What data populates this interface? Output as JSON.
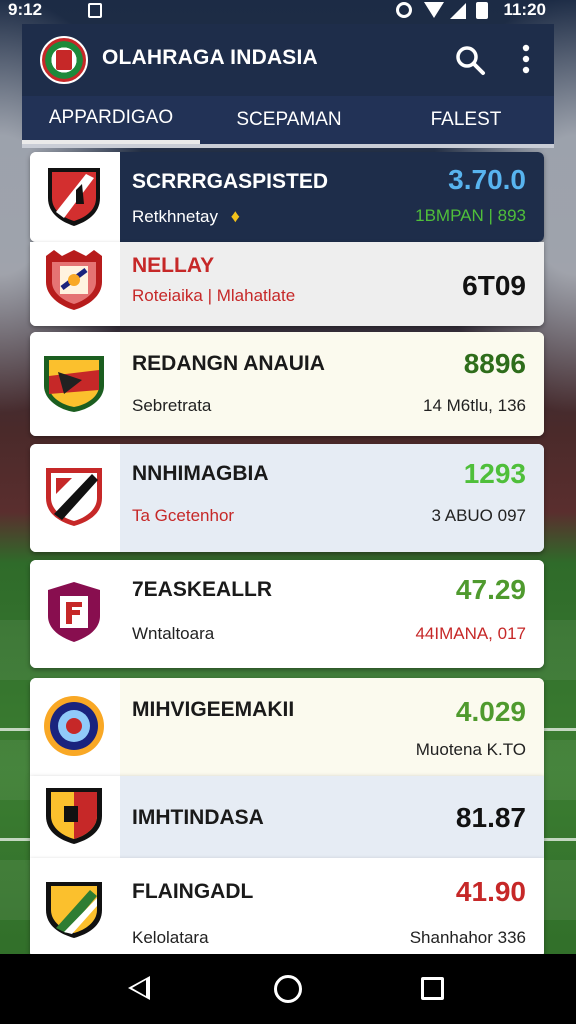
{
  "status_bar": {
    "time": "9:12",
    "clock": "11:20"
  },
  "app": {
    "title": "OLAHRAGA INDASIA"
  },
  "tabs": [
    {
      "label": "APPARDIGAO",
      "active": true
    },
    {
      "label": "SCEPAMAN",
      "active": false
    },
    {
      "label": "FALEST",
      "active": false
    }
  ],
  "items": [
    {
      "name": "SCRRRGASPISTED",
      "sub": "Retkhnetay",
      "score": "3.70.0",
      "meta": "1BMPAN | 893",
      "theme": "dark",
      "score_color": "#58b4ef",
      "meta_color": "#4fbf3a",
      "sub_badge": "trophy"
    },
    {
      "name": "NELLAY",
      "sub": "Roteiaika | Mlahatlate",
      "score": "6T09",
      "meta": "",
      "theme": "grey",
      "score_color": "#111111",
      "name_color": "#c62828",
      "sub_color": "#c62828"
    },
    {
      "name": "REDANGN ANAUIA",
      "sub": "Sebretrata",
      "score": "8896",
      "meta": "14 M6tlu, 136",
      "theme": "cream",
      "score_color": "#2e6d1b"
    },
    {
      "name": "NNHIMAGBIA",
      "sub": "Ta Gcetenhor",
      "score": "1293",
      "meta": "3 ABUO 097",
      "theme": "blue",
      "score_color": "#4fbf3a",
      "sub_color": "#c62828"
    },
    {
      "name": "7EASKEALLR",
      "sub": "Wntaltoara",
      "score": "47.29",
      "meta": "44IMANA, 017",
      "theme": "white",
      "score_color": "#4f9a2e",
      "meta_color": "#c62828"
    },
    {
      "name": "MIHVIGEEMAKII",
      "sub": "",
      "score": "4.029",
      "meta": "Muotena K.TO",
      "theme": "cream",
      "score_color": "#4f9a2e"
    },
    {
      "name": "IMHTINDASA",
      "sub": "",
      "score": "81.87",
      "meta": "",
      "theme": "blue",
      "score_color": "#111111"
    },
    {
      "name": "FLAINGADL",
      "sub": "Kelolatara",
      "score": "41.90",
      "meta": "Shanhahor 336",
      "theme": "white",
      "score_color": "#c62828"
    }
  ]
}
